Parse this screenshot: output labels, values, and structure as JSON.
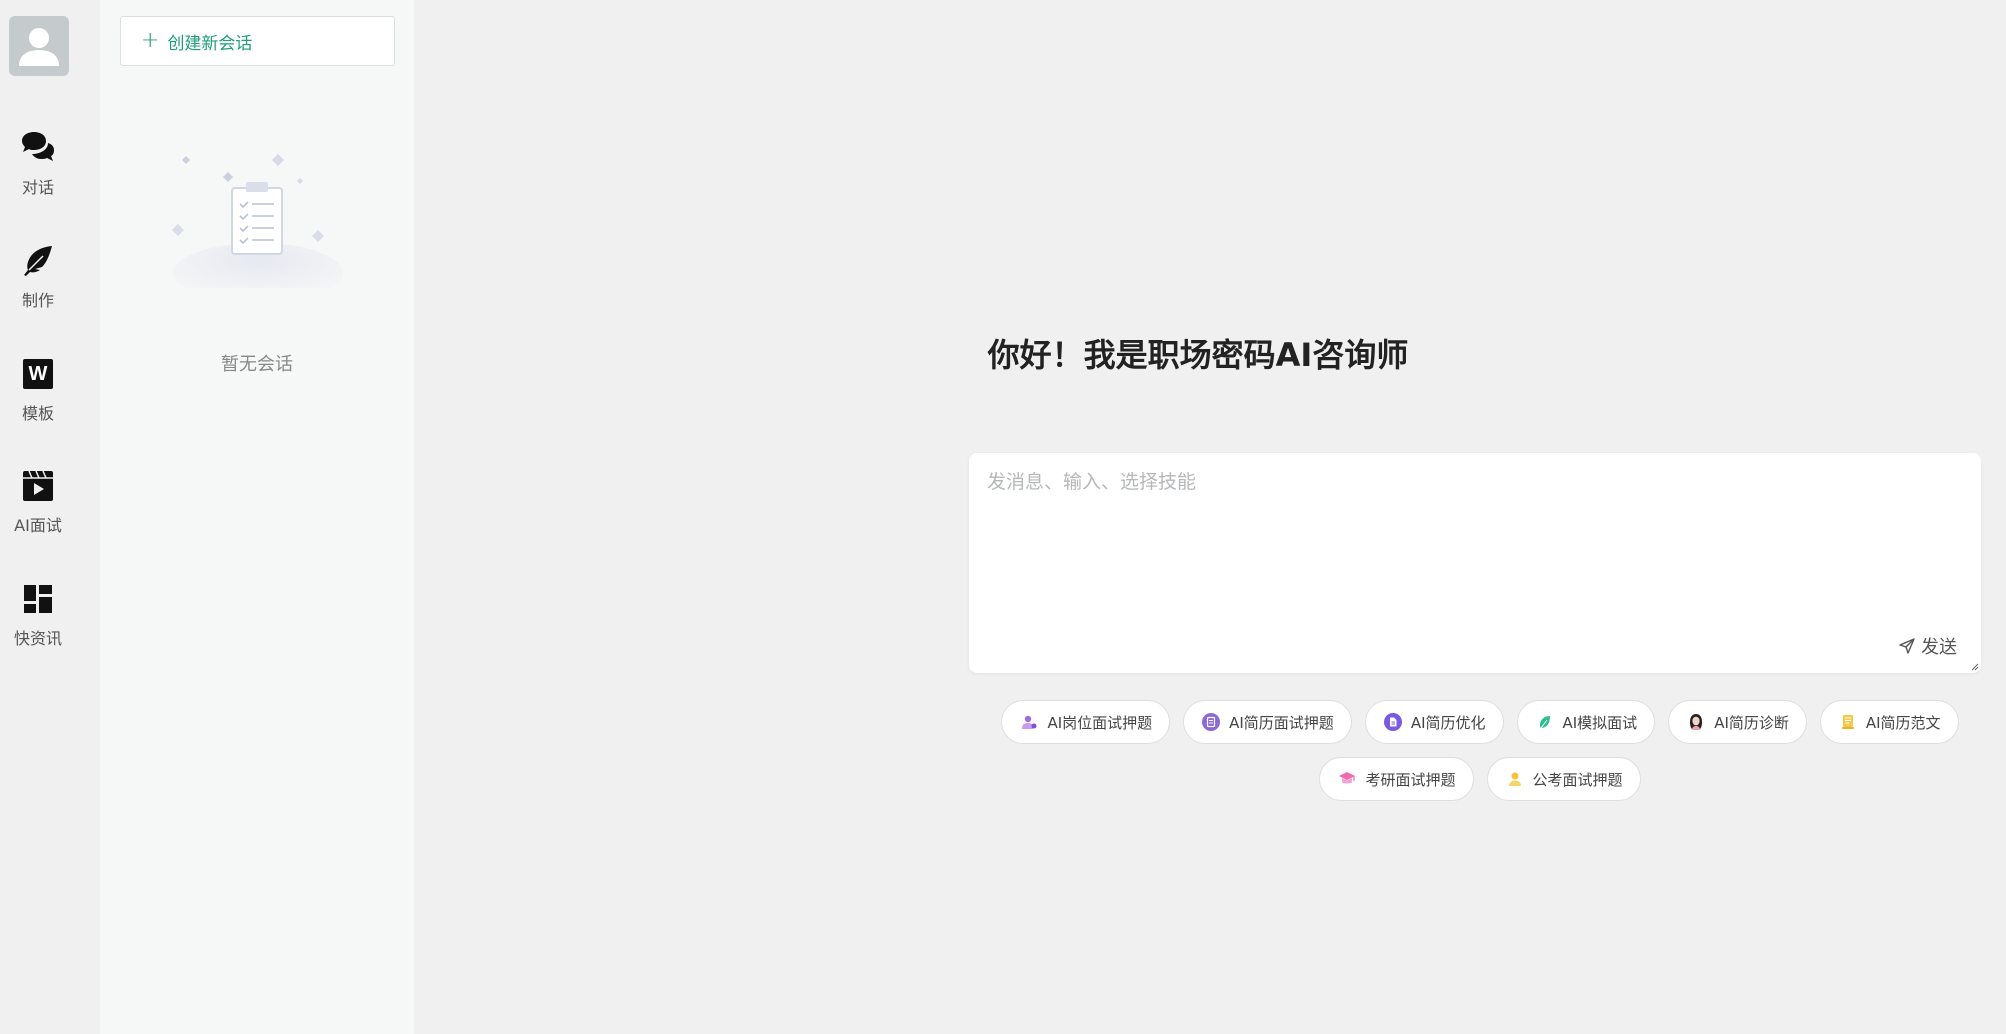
{
  "nav": {
    "items": [
      {
        "label": "对话",
        "icon": "chat-bubbles-icon"
      },
      {
        "label": "制作",
        "icon": "feather-icon"
      },
      {
        "label": "模板",
        "icon": "word-doc-icon",
        "glyph": "W"
      },
      {
        "label": "AI面试",
        "icon": "video-clapper-icon"
      },
      {
        "label": "快资讯",
        "icon": "dashboard-tiles-icon"
      }
    ]
  },
  "panel": {
    "new_chat_label": "创建新会话",
    "empty_text": "暂无会话"
  },
  "main": {
    "title": "你好！我是职场密码AI咨询师",
    "input_placeholder": "发消息、输入、选择技能",
    "send_label": "发送"
  },
  "skills": {
    "row1": [
      {
        "label": "AI岗位面试押题",
        "icon": "person-purple-icon"
      },
      {
        "label": "AI简历面试押题",
        "icon": "document-purple-icon"
      },
      {
        "label": "AI简历优化",
        "icon": "document-violet-icon"
      },
      {
        "label": "AI模拟面试",
        "icon": "leaf-green-icon"
      },
      {
        "label": "AI简历诊断",
        "icon": "person-avatar-icon"
      },
      {
        "label": "AI简历范文",
        "icon": "note-yellow-icon"
      }
    ],
    "row2": [
      {
        "label": "考研面试押题",
        "icon": "graduation-pink-icon"
      },
      {
        "label": "公考面试押题",
        "icon": "person-yellow-icon"
      }
    ]
  },
  "colors": {
    "accent": "#1e9e7a",
    "background": "#eff0ef",
    "panel": "#f6f7f7"
  }
}
